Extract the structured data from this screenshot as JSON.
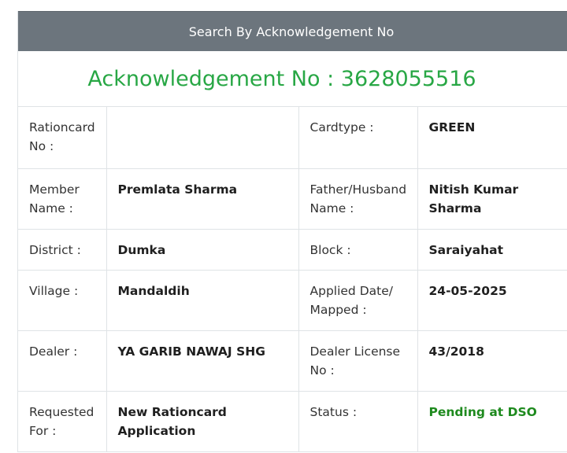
{
  "header": {
    "title": "Search By Acknowledgement No"
  },
  "acknowledgement": {
    "text": "Acknowledgement No : 3628055516"
  },
  "details": {
    "rationcard_label": "Rationcard No :",
    "rationcard_value": "",
    "cardtype_label": "Cardtype :",
    "cardtype_value": "GREEN",
    "member_label": "Member Name :",
    "member_value": "Premlata Sharma",
    "father_label": "Father/Husband Name :",
    "father_value": "Nitish Kumar Sharma",
    "district_label": "District :",
    "district_value": "Dumka",
    "block_label": "Block :",
    "block_value": "Saraiyahat",
    "village_label": "Village :",
    "village_value": "Mandaldih",
    "applied_label": "Applied Date/ Mapped :",
    "applied_value": "24-05-2025",
    "dealer_label": "Dealer :",
    "dealer_value": "YA GARIB NAWAJ SHG",
    "license_label": "Dealer License No :",
    "license_value": "43/2018",
    "requested_label": "Requested For :",
    "requested_value": "New Rationcard Application",
    "status_label": "Status :",
    "status_value": "Pending at DSO"
  },
  "colors": {
    "header_bg": "#6c757d",
    "acknowledgement_text": "#28a745",
    "status_pending": "#1e8a1e"
  }
}
